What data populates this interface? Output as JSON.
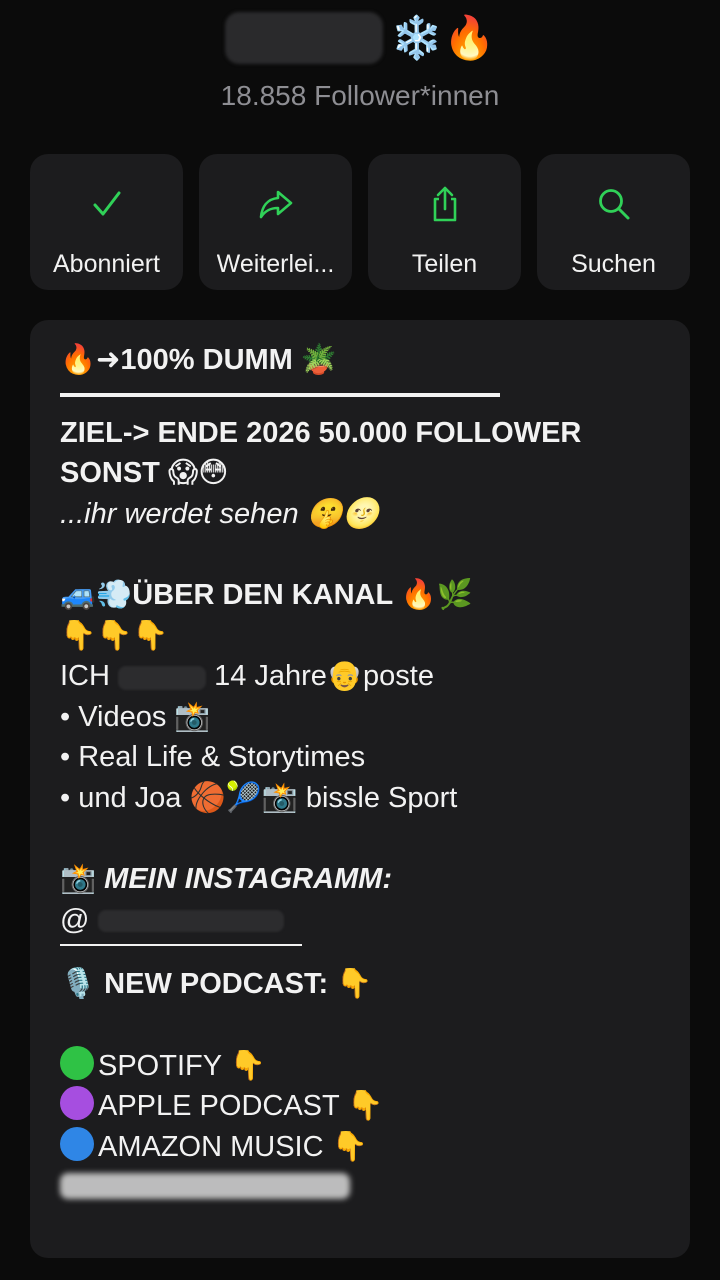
{
  "header": {
    "name_emojis": "❄️🔥",
    "followers": "18.858 Follower*innen"
  },
  "actions": [
    {
      "label": "Abonniert",
      "icon": "check-icon"
    },
    {
      "label": "Weiterlei...",
      "icon": "forward-arrow-icon"
    },
    {
      "label": "Teilen",
      "icon": "share-icon"
    },
    {
      "label": "Suchen",
      "icon": "search-icon"
    }
  ],
  "accent_color": "#30d158",
  "description": {
    "title": "🔥➜100% DUMM 🪴",
    "goal_line1": "ZIEL-> ENDE 2026 50.000 FOLLOWER",
    "goal_line2": "SONST 😱😳",
    "goal_line3": "...ihr werdet sehen 🤫🌝",
    "about_heading": "🚙💨ÜBER DEN KANAL 🔥🌿",
    "pointers": "👇👇👇",
    "intro_prefix": "ICH",
    "intro_suffix": "14 Jahre👴poste",
    "bullet1": "• Videos 📸",
    "bullet2": "• Real Life & Storytimes",
    "bullet3": "• und Joa 🏀🎾📸 bissle Sport",
    "instagram_heading_emoji": "📸",
    "instagram_heading": "MEIN INSTAGRAMM:",
    "instagram_handle_prefix": "@",
    "podcast_heading": "🎙️ NEW PODCAST: 👇",
    "spotify": "SPOTIFY 👇",
    "apple": "APPLE PODCAST 👇",
    "amazon": "AMAZON MUSIC 👇"
  }
}
